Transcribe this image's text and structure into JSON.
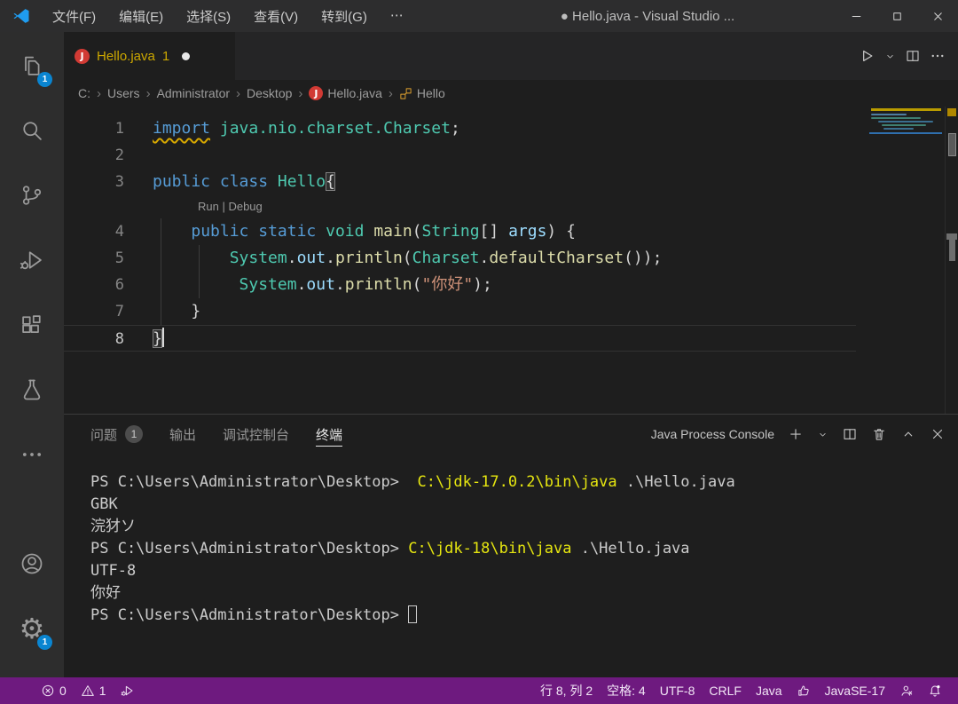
{
  "window": {
    "title": "● Hello.java - Visual Studio ...",
    "controls": [
      {
        "icon": "minimize",
        "name": "minimize-button"
      },
      {
        "icon": "maximize",
        "name": "maximize-button"
      },
      {
        "icon": "close",
        "name": "close-button"
      }
    ]
  },
  "menu": [
    "文件(F)",
    "编辑(E)",
    "选择(S)",
    "查看(V)",
    "转到(G)",
    "⋯"
  ],
  "activity_bar": {
    "top": [
      {
        "icon": "explorer",
        "badge": "1",
        "name": "explorer"
      },
      {
        "icon": "search",
        "name": "search"
      },
      {
        "icon": "source-control",
        "name": "source-control"
      },
      {
        "icon": "run-debug",
        "name": "run-and-debug"
      },
      {
        "icon": "extensions",
        "name": "extensions"
      },
      {
        "icon": "testing",
        "name": "testing"
      },
      {
        "icon": "more-dots",
        "name": "additional-views"
      }
    ],
    "bottom": [
      {
        "icon": "account",
        "name": "accounts"
      },
      {
        "icon": "settings-gear",
        "badge": "1",
        "name": "settings"
      }
    ]
  },
  "tab": {
    "label": "Hello.java",
    "badge": "1",
    "modified": true
  },
  "editor_actions": [
    {
      "icon": "run",
      "name": "run-button"
    },
    {
      "icon": "chevron-down-small",
      "name": "run-dropdown"
    },
    {
      "icon": "split-editor",
      "name": "split-editor-button"
    },
    {
      "icon": "more-dots",
      "name": "more-actions-button"
    }
  ],
  "breadcrumb": [
    {
      "label": "C:"
    },
    {
      "label": "Users"
    },
    {
      "label": "Administrator"
    },
    {
      "label": "Desktop"
    },
    {
      "label": "Hello.java",
      "icon": "java-file"
    },
    {
      "label": "Hello",
      "icon": "symbol-class"
    }
  ],
  "editor": {
    "codelens_label": "Run | Debug",
    "token_colors": {
      "k": "#569cd6",
      "t": "#4ec9b0",
      "f": "#dcdcaa",
      "v": "#9cdcfe",
      "s": "#ce9178",
      "p": "#d4d4d4"
    },
    "lines": [
      {
        "num": "1",
        "tokens": [
          {
            "t": "import",
            "c": "k",
            "squiggle": true
          },
          {
            "t": " ",
            "c": "p"
          },
          {
            "t": "java.nio.charset.Charset",
            "c": "t"
          },
          {
            "t": ";",
            "c": "p"
          }
        ]
      },
      {
        "num": "2",
        "tokens": []
      },
      {
        "num": "3",
        "tokens": [
          {
            "t": "public",
            "c": "k"
          },
          {
            "t": " ",
            "c": "p"
          },
          {
            "t": "class",
            "c": "k"
          },
          {
            "t": " ",
            "c": "p"
          },
          {
            "t": "Hello",
            "c": "t"
          },
          {
            "t": "{",
            "c": "p",
            "box": true
          }
        ]
      },
      {
        "num": "4",
        "codelens": true,
        "tokens": [
          {
            "t": "    ",
            "c": "p"
          },
          {
            "t": "public",
            "c": "k"
          },
          {
            "t": " ",
            "c": "p"
          },
          {
            "t": "static",
            "c": "k"
          },
          {
            "t": " ",
            "c": "p"
          },
          {
            "t": "void",
            "c": "t"
          },
          {
            "t": " ",
            "c": "p"
          },
          {
            "t": "main",
            "c": "f"
          },
          {
            "t": "(",
            "c": "p"
          },
          {
            "t": "String",
            "c": "t"
          },
          {
            "t": "[] ",
            "c": "p"
          },
          {
            "t": "args",
            "c": "v"
          },
          {
            "t": ") {",
            "c": "p"
          }
        ]
      },
      {
        "num": "5",
        "tokens": [
          {
            "t": "        ",
            "c": "p"
          },
          {
            "t": "System",
            "c": "t"
          },
          {
            "t": ".",
            "c": "p"
          },
          {
            "t": "out",
            "c": "v"
          },
          {
            "t": ".",
            "c": "p"
          },
          {
            "t": "println",
            "c": "f"
          },
          {
            "t": "(",
            "c": "p"
          },
          {
            "t": "Charset",
            "c": "t"
          },
          {
            "t": ".",
            "c": "p"
          },
          {
            "t": "defaultCharset",
            "c": "f"
          },
          {
            "t": "());",
            "c": "p"
          }
        ]
      },
      {
        "num": "6",
        "tokens": [
          {
            "t": "         ",
            "c": "p"
          },
          {
            "t": "System",
            "c": "t"
          },
          {
            "t": ".",
            "c": "p"
          },
          {
            "t": "out",
            "c": "v"
          },
          {
            "t": ".",
            "c": "p"
          },
          {
            "t": "println",
            "c": "f"
          },
          {
            "t": "(",
            "c": "p"
          },
          {
            "t": "\"你好\"",
            "c": "s"
          },
          {
            "t": ");",
            "c": "p"
          }
        ]
      },
      {
        "num": "7",
        "tokens": [
          {
            "t": "    }",
            "c": "p"
          }
        ]
      },
      {
        "num": "8",
        "current": true,
        "caret": true,
        "tokens": [
          {
            "t": "}",
            "c": "p",
            "box": true
          }
        ]
      }
    ]
  },
  "panel": {
    "tabs": [
      {
        "label": "问题",
        "badge": "1",
        "name": "tab-problems"
      },
      {
        "label": "输出",
        "name": "tab-output"
      },
      {
        "label": "调试控制台",
        "name": "tab-debug-console"
      },
      {
        "label": "终端",
        "active": true,
        "name": "tab-terminal"
      }
    ],
    "console_label": "Java Process Console",
    "actions": [
      {
        "icon": "plus",
        "name": "new-terminal-button"
      },
      {
        "icon": "chevron-down-small",
        "name": "terminal-dropdown"
      },
      {
        "icon": "split-editor",
        "name": "split-terminal-button"
      },
      {
        "icon": "trash",
        "name": "kill-terminal-button"
      },
      {
        "icon": "chevron-up",
        "name": "maximize-panel-button"
      },
      {
        "icon": "close",
        "name": "close-panel-button"
      }
    ]
  },
  "terminal": {
    "command_color": "#e5e510",
    "lines": [
      {
        "spans": [
          {
            "t": "PS C:\\Users\\Administrator\\Desktop>  ",
            "c": "fg"
          },
          {
            "t": "C:\\jdk-17.0.2\\bin\\java",
            "c": "cmd"
          },
          {
            "t": " .\\Hello.java",
            "c": "fg"
          }
        ]
      },
      {
        "spans": [
          {
            "t": "GBK",
            "c": "fg"
          }
        ]
      },
      {
        "spans": [
          {
            "t": "浣犲ソ",
            "c": "fg"
          }
        ]
      },
      {
        "spans": [
          {
            "t": "PS C:\\Users\\Administrator\\Desktop> ",
            "c": "fg"
          },
          {
            "t": "C:\\jdk-18\\bin\\java",
            "c": "cmd"
          },
          {
            "t": " .\\Hello.java",
            "c": "fg"
          }
        ]
      },
      {
        "spans": [
          {
            "t": "UTF-8",
            "c": "fg"
          }
        ]
      },
      {
        "spans": [
          {
            "t": "你好",
            "c": "fg"
          }
        ]
      },
      {
        "spans": [
          {
            "t": "PS C:\\Users\\Administrator\\Desktop> ",
            "c": "fg"
          }
        ],
        "cursor": true
      }
    ]
  },
  "status_bar": {
    "background": "#6e1a7f",
    "left": [
      {
        "icon": "error-circle",
        "label": "0",
        "name": "problems-errors"
      },
      {
        "icon": "warning-triangle",
        "label": "1",
        "name": "problems-warnings"
      },
      {
        "icon": "debug-run",
        "label": "",
        "name": "quick-run"
      }
    ],
    "right": [
      {
        "label": "行 8, 列 2",
        "name": "cursor-position"
      },
      {
        "label": "空格: 4",
        "name": "indentation"
      },
      {
        "label": "UTF-8",
        "name": "encoding"
      },
      {
        "label": "CRLF",
        "name": "eol"
      },
      {
        "label": "Java",
        "name": "language-mode"
      },
      {
        "icon": "thumbs-up",
        "label": "",
        "name": "feedback"
      },
      {
        "label": "JavaSE-17",
        "name": "java-runtime"
      },
      {
        "icon": "person",
        "label": "",
        "name": "java-status"
      },
      {
        "icon": "bell-dot",
        "label": "",
        "name": "notifications"
      }
    ]
  },
  "colors": {
    "badge_blue": "#0a85d1",
    "tab_warning_label": "#cca700",
    "java_icon_red": "#d13a34",
    "class_icon_orange": "#e2a32e",
    "logo_blue": "#1f9cf0"
  }
}
